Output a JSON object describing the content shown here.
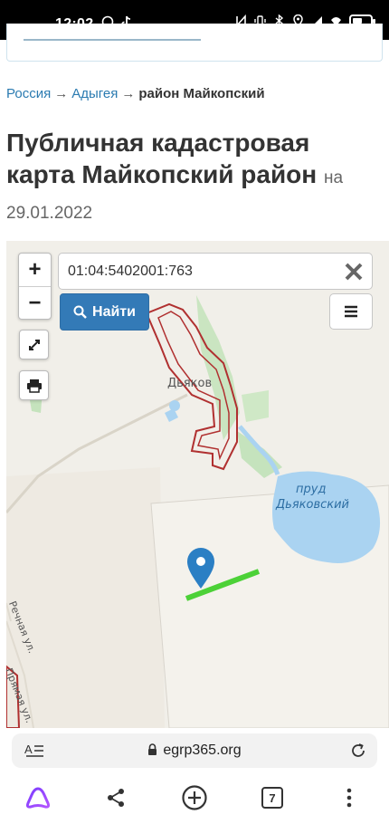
{
  "status_bar": {
    "time": "12:02"
  },
  "breadcrumb": {
    "items": [
      "Россия",
      "Адыгея"
    ],
    "separator": "→",
    "current": "район Майкопский"
  },
  "page": {
    "title": "Публичная кадастровая карта Майкопский район",
    "date_prefix": "на",
    "date": "29.01.2022"
  },
  "map": {
    "search_value": "01:04:5402001:763",
    "find_label": "Найти",
    "zoom_in_label": "+",
    "zoom_out_label": "−",
    "labels": {
      "village": "Дьяков",
      "pond_line1": "пруд",
      "pond_line2": "Дьяковский",
      "street1": "Прямая ул.",
      "street2": "Речная ул."
    },
    "colors": {
      "cadastral_border": "#b03030",
      "water": "#aad3f1",
      "parcel": "#4cd137",
      "marker": "#2b7fc4",
      "button": "#337ab7"
    }
  },
  "browser": {
    "url": "egrp365.org",
    "tab_count": "7"
  }
}
